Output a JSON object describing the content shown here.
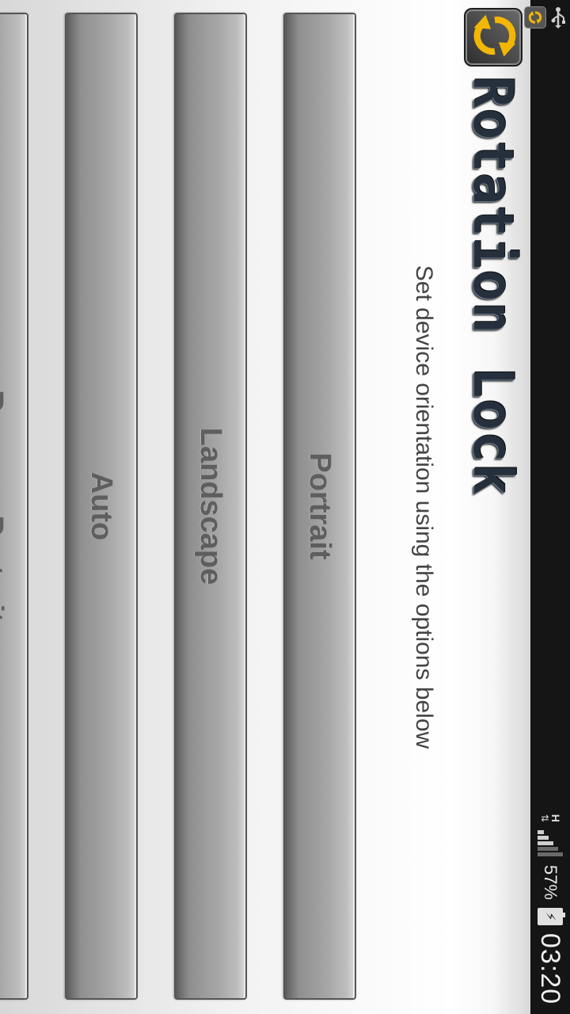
{
  "status_bar": {
    "usb_icon": "usb-icon",
    "notification_icon": "rotation-lock-mini-icon",
    "network_type": "H",
    "signal_icon": "signal-bars-icon",
    "battery_percent": "57%",
    "battery_icon": "battery-charging-icon",
    "time": "03:20"
  },
  "header": {
    "app_icon": "rotation-arrows-icon",
    "title": "Rotation Lock"
  },
  "instruction": "Set device orientation using the options below",
  "options": [
    {
      "label": "Portrait"
    },
    {
      "label": "Landscape"
    },
    {
      "label": "Auto"
    },
    {
      "label": "Reverse Portrait"
    }
  ],
  "colors": {
    "status_bar_bg": "#151515",
    "accent_yellow": "#f2b705",
    "title_color": "#26303c"
  }
}
